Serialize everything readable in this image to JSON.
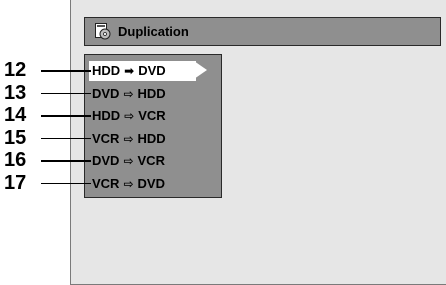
{
  "header": {
    "title": "Duplication",
    "icon": "duplication-icon"
  },
  "menu": {
    "items": [
      {
        "callout": "12",
        "from": "HDD",
        "to": "DVD",
        "selected": true
      },
      {
        "callout": "13",
        "from": "DVD",
        "to": "HDD",
        "selected": false
      },
      {
        "callout": "14",
        "from": "HDD",
        "to": "VCR",
        "selected": false
      },
      {
        "callout": "15",
        "from": "VCR",
        "to": "HDD",
        "selected": false
      },
      {
        "callout": "16",
        "from": "DVD",
        "to": "VCR",
        "selected": false
      },
      {
        "callout": "17",
        "from": "VCR",
        "to": "DVD",
        "selected": false
      }
    ],
    "selected_arrow": "➡",
    "unselected_arrow": "⇨"
  },
  "colors": {
    "panel_bg": "#8f8f8f",
    "screen_bg": "#e6e6e6",
    "highlight_bg": "#ffffff"
  }
}
